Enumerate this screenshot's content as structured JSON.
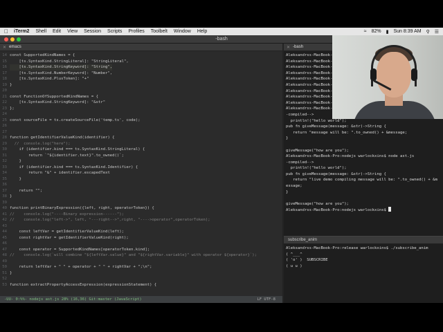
{
  "menubar": {
    "app": "iTerm2",
    "items": [
      "Shell",
      "Edit",
      "View",
      "Session",
      "Scripts",
      "Profiles",
      "Toolbelt",
      "Window",
      "Help"
    ],
    "battery": "82%",
    "clock": "Sun 8:39 AM"
  },
  "window": {
    "title": "-bash"
  },
  "editor": {
    "tab": "emacs",
    "lines": [
      {
        "n": "14",
        "t": "const SupportedKindNames = {"
      },
      {
        "n": "15",
        "t": "    [ts.SyntaxKind.StringLiteral]: \"StringLiteral\","
      },
      {
        "n": "16",
        "t": "    [ts.SyntaxKind.StringKeyword]: \"String\","
      },
      {
        "n": "17",
        "t": "    [ts.SyntaxKind.NumberKeyword]: \"Number\","
      },
      {
        "n": "18",
        "t": "    [ts.SyntaxKind.PlusToken]: \"+\""
      },
      {
        "n": "19",
        "t": "}"
      },
      {
        "n": "20",
        "t": ""
      },
      {
        "n": "21",
        "t": "const FunctionOfSupportedKindNames = {"
      },
      {
        "n": "22",
        "t": "    [ts.SyntaxKind.StringKeyword]: \"&str\""
      },
      {
        "n": "23",
        "t": "};"
      },
      {
        "n": "24",
        "t": ""
      },
      {
        "n": "25",
        "t": "const sourceFile = ts.createSourceFile('temp.ts', code);"
      },
      {
        "n": "26",
        "t": ""
      },
      {
        "n": "27",
        "t": ""
      },
      {
        "n": "28",
        "t": "function getIdentifierValueKind(identifier) {"
      },
      {
        "n": "29",
        "t": "  //  console.log(\"here\");"
      },
      {
        "n": "30",
        "t": "    if (identifier.kind === ts.SyntaxKind.StringLiteral) {"
      },
      {
        "n": "31",
        "t": "        return `\"${identifier.text}\".to_owned()`;"
      },
      {
        "n": "32",
        "t": "    }"
      },
      {
        "n": "33",
        "t": "    if (identifier.kind === ts.SyntaxKind.Identifier) {"
      },
      {
        "n": "34",
        "t": "        return \"&\" + identifier.escapedText"
      },
      {
        "n": "35",
        "t": "    }"
      },
      {
        "n": "36",
        "t": ""
      },
      {
        "n": "37",
        "t": "    return \"\";"
      },
      {
        "n": "38",
        "t": "}"
      },
      {
        "n": "39",
        "t": ""
      },
      {
        "n": "40",
        "t": "function printBinaryExpression({left, right, operatorToken}) {"
      },
      {
        "n": "41",
        "t": "//    console.log(\"----Binary expression------\");"
      },
      {
        "n": "42",
        "t": "//    console.log(\"left->\", left, \"---right-->\",right, \"---->operator\",operatorToken);"
      },
      {
        "n": "43",
        "t": ""
      },
      {
        "n": "44",
        "t": "    const leftVar = getIdentifierValueKind(left);"
      },
      {
        "n": "45",
        "t": "    const rightVar = getIdentifierValueKind(right);"
      },
      {
        "n": "46",
        "t": ""
      },
      {
        "n": "47",
        "t": "    const operator = SupportedKindNames[operatorToken.kind];"
      },
      {
        "n": "48",
        "t": "//    console.log(`will combine \"${leftVar.value}\" and \"${rightVar.variable}\" with operator ${operator}`);"
      },
      {
        "n": "49",
        "t": ""
      },
      {
        "n": "50",
        "t": "    return leftVar + \" \" + operator + \" \" + rightVar + \";\\n\";"
      },
      {
        "n": "51",
        "t": "}"
      },
      {
        "n": "52",
        "t": ""
      },
      {
        "n": "53",
        "t": "function extractPropertyAccessExpression(expressionStatement) {"
      }
    ],
    "modeline_left": "-UU-  0:%%-  nodejs ast.js    28% (16,36)  Git:master  (JavaScript)",
    "modeline_right": "LF  UTF-8"
  },
  "terminal": {
    "tab": "-bash",
    "lines": [
      "Aleksandrss-MacBook-",
      "Aleksandrss-MacBook-",
      "Aleksandrss-MacBook-",
      "Aleksandrss-MacBook-",
      "Aleksandrss-MacBook-",
      "Aleksandrss-MacBook-",
      "Aleksandrss-MacBook-",
      "Aleksandrss-MacBook-",
      "Aleksandrss-MacBook-",
      "Aleksandrss-MacBook-Pro:nodejs warlockxins$ node ast.js",
      "-compiled-->",
      "  println!(\"hello world\");",
      "pub fn giveMessage(message: &str)->String {",
      "   return \"message will be: \".to_owned() + &message;",
      "}",
      "",
      "giveMessage(\"how are you\");",
      "Aleksandrss-MacBook-Pro:nodejs warlockxins$ node ast.js",
      "-compiled-->",
      "  println!(\"hello world\");",
      "pub fn giveMessage(message: &str)->String {",
      "   return \"live demo compiling message will be: \".to_owned() + &m",
      "essage;",
      "}",
      "",
      "giveMessage(\"how are you\");",
      "Aleksandrss-MacBook-Pro:nodejs warlockxins$ "
    ],
    "lower_tab": "subscribe_anim",
    "lower_lines": [
      "Aleksandrss-MacBook-Pro:release warlockxins$ ./subscribe_anim",
      "( ^___^",
      "( 'o' )  SUBSCRIBE",
      "( u u )"
    ]
  }
}
